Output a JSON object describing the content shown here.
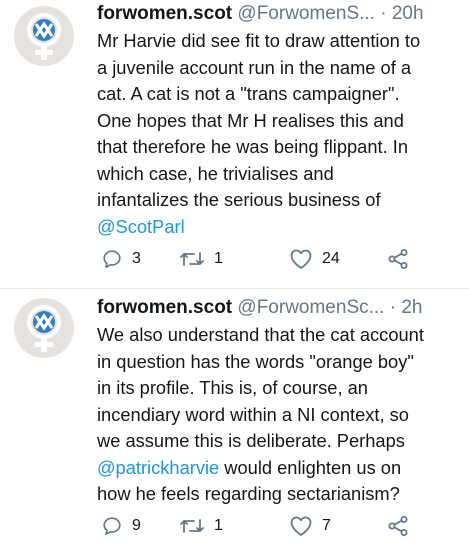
{
  "tweets": [
    {
      "display_name": "forwomen.scot",
      "handle": "@ForwomenS...",
      "separator": "·",
      "time": "20h",
      "body_lines": [
        "Mr Harvie did see fit to draw attention to",
        "a juvenile account run in the name of a",
        "cat. A cat is not a \"trans campaigner\".",
        "One hopes that Mr H realises this and",
        "that therefore he was being flippant. In",
        "which case, he trivialises and",
        "infantalizes the serious business of"
      ],
      "mention": "@ScotParl",
      "replies": "3",
      "retweets": "1",
      "likes": "24"
    },
    {
      "display_name": "forwomen.scot",
      "handle": "@ForwomenSc...",
      "separator": "·",
      "time": "2h",
      "body_lines": [
        "We also understand that the cat account",
        "in question has the words \"orange boy\"",
        "in its profile. This is, of course, an",
        "incendiary word within a NI context, so",
        "we assume this is deliberate. Perhaps"
      ],
      "mention": "@patrickharvie",
      "mention_tail": " would enlighten us on",
      "last_line": "how he feels regarding sectarianism?",
      "replies": "9",
      "retweets": "1",
      "likes": "7"
    }
  ],
  "colors": {
    "text": "#14171a",
    "secondary": "#657786",
    "link": "#1b95e0",
    "avatar_bg": "#e6e2df",
    "logo_blue": "#2f7fc1"
  },
  "icons": [
    "avatar-logo",
    "reply-icon",
    "retweet-icon",
    "like-icon",
    "share-icon"
  ]
}
